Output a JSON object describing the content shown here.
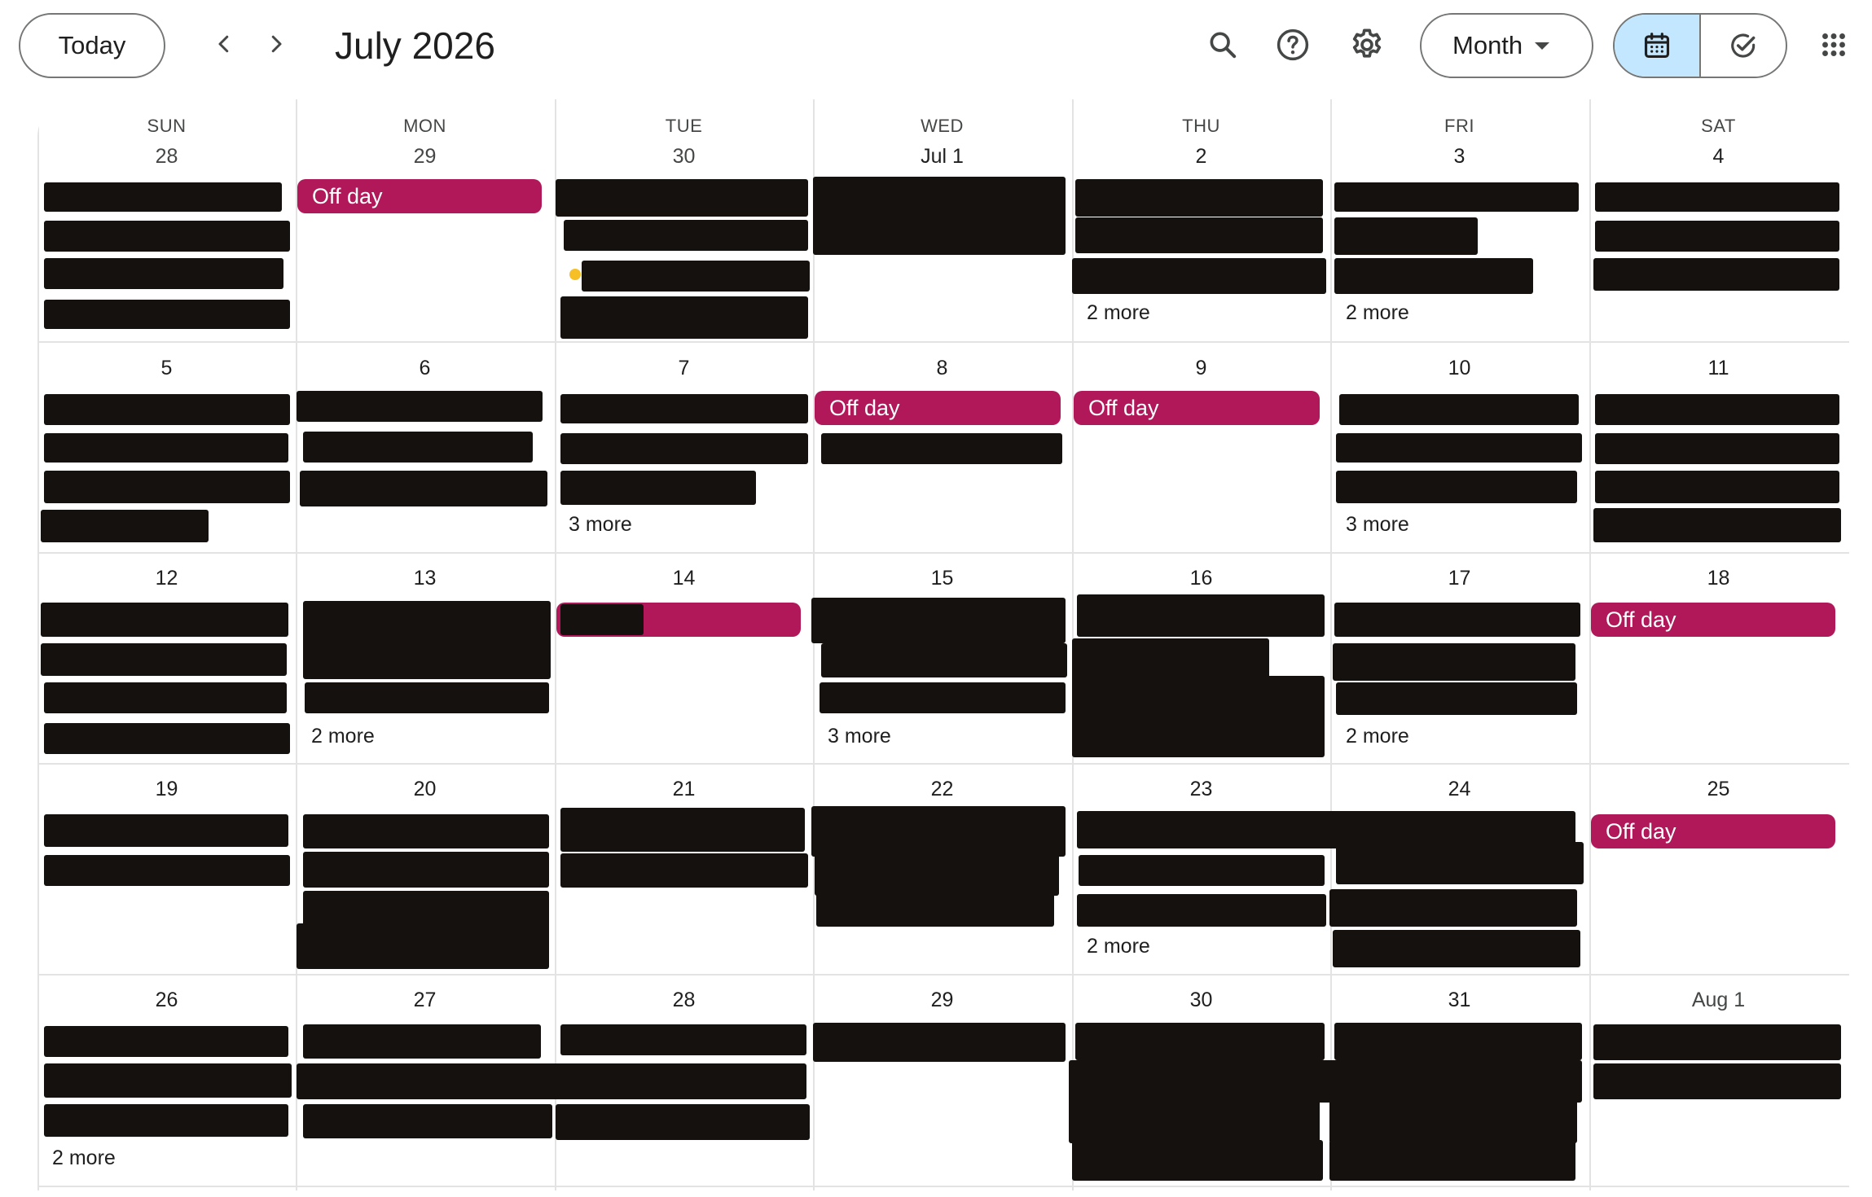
{
  "header": {
    "today_label": "Today",
    "title": "July 2026",
    "view_label": "Month",
    "icons": {
      "prev": "chevron-left-icon",
      "next": "chevron-right-icon",
      "search": "search-icon",
      "help": "help-icon",
      "settings": "gear-icon",
      "view_caret": "caret-down-icon",
      "calendar": "calendar-icon",
      "tasks": "tasks-check-icon",
      "apps": "apps-grid-icon"
    }
  },
  "colors": {
    "accent_selected": "#c2e7ff",
    "off_day": "#b0185a",
    "redaction": "#14110f",
    "task_dot": "#f6bf26"
  },
  "weekdays": [
    "SUN",
    "MON",
    "TUE",
    "WED",
    "THU",
    "FRI",
    "SAT"
  ],
  "weeks": [
    [
      "28",
      "29",
      "30",
      "Jul 1",
      "2",
      "3",
      "4"
    ],
    [
      "5",
      "6",
      "7",
      "8",
      "9",
      "10",
      "11"
    ],
    [
      "12",
      "13",
      "14",
      "15",
      "16",
      "17",
      "18"
    ],
    [
      "19",
      "20",
      "21",
      "22",
      "23",
      "24",
      "25"
    ],
    [
      "26",
      "27",
      "28",
      "29",
      "30",
      "31",
      "Aug 1"
    ]
  ],
  "off_day_label": "Off day",
  "more": {
    "w1_thu": "2 more",
    "w1_fri": "2 more",
    "w2_tue": "3 more",
    "w2_fri": "3 more",
    "w3_mon": "2 more",
    "w3_wed": "3 more",
    "w3_fri": "2 more",
    "w4_thu": "2 more",
    "w5_sun": "2 more"
  }
}
